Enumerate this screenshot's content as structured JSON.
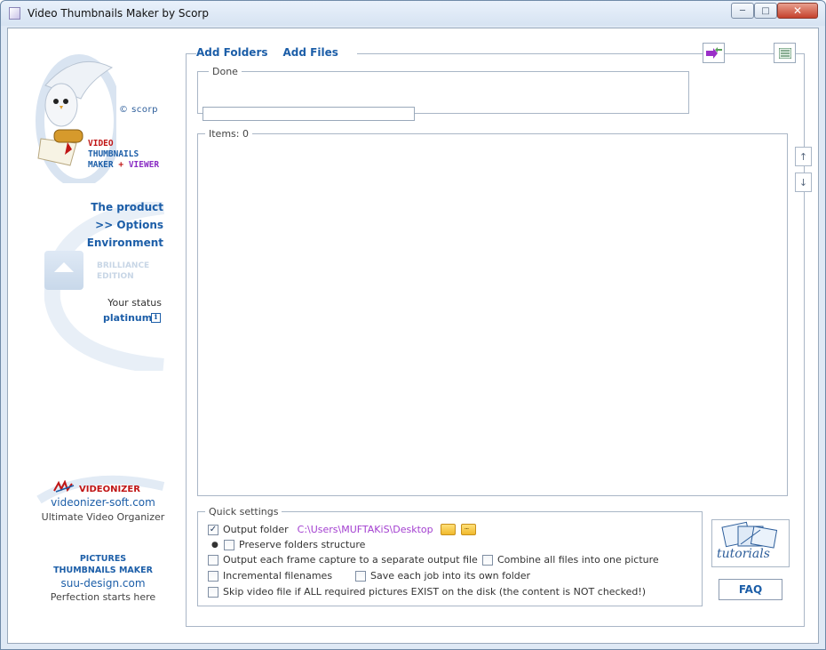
{
  "window": {
    "title": "Video Thumbnails Maker by Scorp",
    "min_label": "─",
    "max_label": "□",
    "close_label": "✕"
  },
  "left_panel": {
    "copyright": "© scorp",
    "logo_line1": "VIDEO",
    "logo_line2": "THUMBNAILS",
    "logo_line3a": "MAKER",
    "logo_line3b": "+",
    "logo_line3c": "VIEWER",
    "nav": {
      "product": "The product",
      "options": ">> Options",
      "environment": "Environment"
    },
    "edition_line1": "BRILLIANCE",
    "edition_line2": "EDITION",
    "status_label": "Your status",
    "status_value": "platinum",
    "info_glyph": "i",
    "videonizer": {
      "name": "VIDEONIZER",
      "url": "videonizer-soft.com",
      "tagline": "Ultimate Video Organizer"
    },
    "pictures": {
      "line1": "PICTURES",
      "line2": "THUMBNAILS MAKER",
      "url": "suu-design.com",
      "tagline": "Perfection starts here"
    }
  },
  "main": {
    "add_folders": "Add Folders",
    "add_files": "Add Files",
    "done_label": "Done",
    "items_label": "Items: 0",
    "up_glyph": "↑",
    "down_glyph": "↓",
    "quick_settings": {
      "title": "Quick settings",
      "output_folder_label": "Output folder",
      "output_folder_checked": true,
      "output_folder_path": "C:\\Users\\MUFTAKiS\\Desktop",
      "browse_dots": "...",
      "preserve_structure": "Preserve folders structure",
      "separate_file": "Output each frame capture to a separate output file",
      "combine_all": "Combine all files into one picture",
      "incremental": "Incremental filenames",
      "own_folder": "Save each job into its own folder",
      "skip_existing": "Skip video file if ALL required pictures EXIST on the disk (the content is NOT checked!)",
      "check_glyph": "✓"
    },
    "tutorials_label": "tutorials",
    "faq_label": "FAQ"
  },
  "colors": {
    "link_blue": "#1c5ea8",
    "red": "#c01515",
    "purple": "#8a2ec4",
    "path_purple": "#a33fd0"
  }
}
